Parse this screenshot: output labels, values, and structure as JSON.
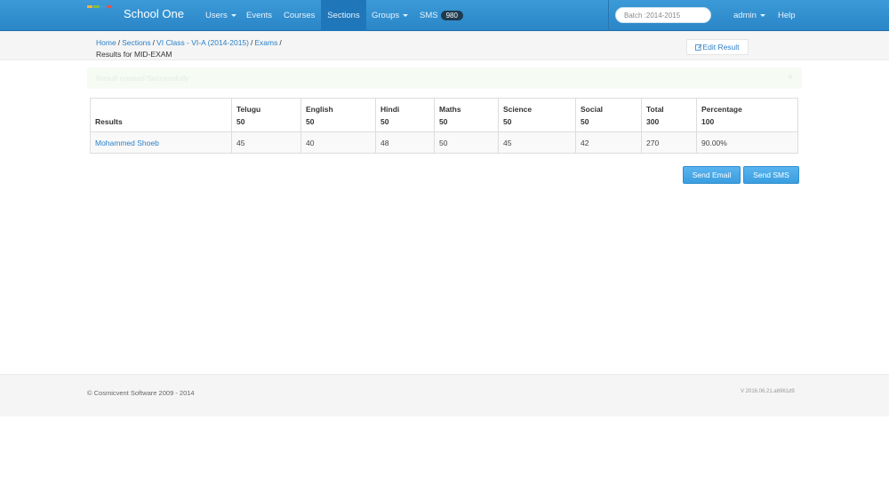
{
  "navbar": {
    "brand": "School One",
    "logo_colors": [
      "#f0b53b",
      "#7dc043",
      "#3c9ad8",
      "#e2554b"
    ],
    "items": [
      {
        "label": "Users",
        "dropdown": true
      },
      {
        "label": "Events",
        "dropdown": false
      },
      {
        "label": "Courses",
        "dropdown": false
      },
      {
        "label": "Sections",
        "dropdown": false,
        "active": true
      },
      {
        "label": "Groups",
        "dropdown": true
      }
    ],
    "sms": {
      "label": "SMS",
      "count": "980"
    },
    "batch_value": "Batch :2014-2015",
    "admin_label": "admin",
    "help_label": "Help"
  },
  "breadcrumb": {
    "home": "Home",
    "sections": "Sections",
    "section_name": "VI Class - VI-A (2014-2015)",
    "exams": "Exams",
    "sep": "/",
    "current": "Results for MID-EXAM"
  },
  "edit_result": {
    "icon": "edit-icon",
    "label": "Edit Result"
  },
  "alert": {
    "message": "Result created Successfully",
    "close": "×"
  },
  "table": {
    "first_header": "Results",
    "subjects": [
      {
        "name": "Telugu",
        "max": "50"
      },
      {
        "name": "English",
        "max": "50"
      },
      {
        "name": "Hindi",
        "max": "50"
      },
      {
        "name": "Maths",
        "max": "50"
      },
      {
        "name": "Science",
        "max": "50"
      },
      {
        "name": "Social",
        "max": "50"
      },
      {
        "name": "Total",
        "max": "300"
      },
      {
        "name": "Percentage",
        "max": "100"
      }
    ],
    "rows": [
      {
        "student": "Mohammed Shoeb",
        "scores": [
          "45",
          "40",
          "48",
          "50",
          "45",
          "42",
          "270",
          "90.00%"
        ]
      }
    ]
  },
  "buttons": {
    "send_email": "Send Email",
    "send_sms": "Send SMS"
  },
  "footer": {
    "copyright": "© Cosmicvent Software 2009 - 2014",
    "version": "V 2016.06.21.a6961d9"
  }
}
